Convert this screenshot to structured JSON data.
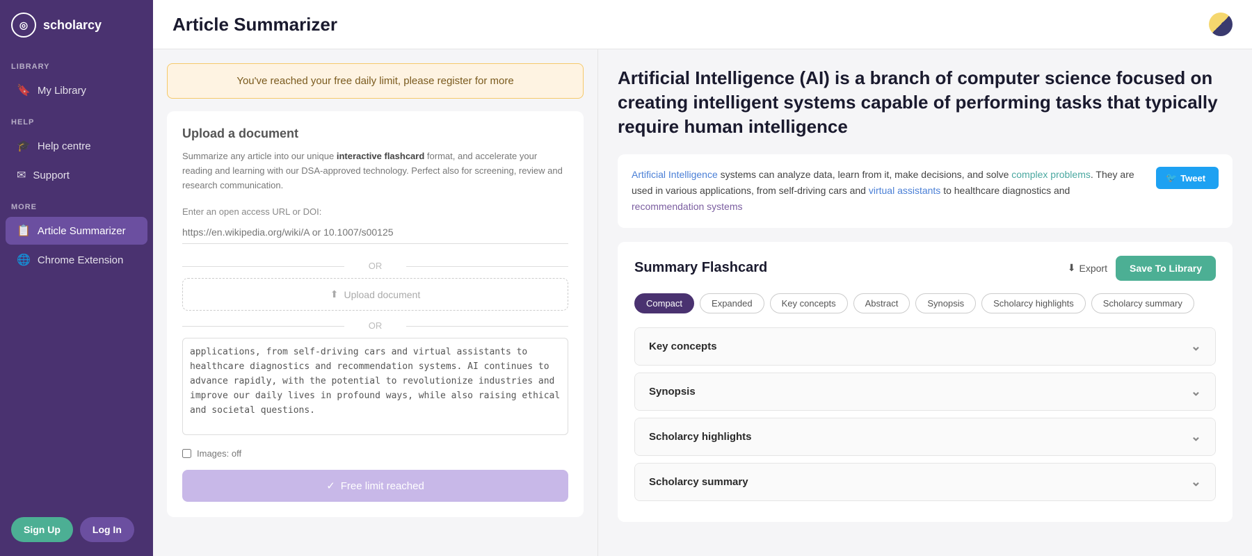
{
  "app": {
    "name": "scholarcy",
    "logo_symbol": "◎"
  },
  "sidebar": {
    "sections": [
      {
        "label": "LIBRARY",
        "items": [
          {
            "id": "my-library",
            "label": "My Library",
            "icon": "🔖",
            "active": false
          }
        ]
      },
      {
        "label": "HELP",
        "items": [
          {
            "id": "help-centre",
            "label": "Help centre",
            "icon": "🎓",
            "active": false
          },
          {
            "id": "support",
            "label": "Support",
            "icon": "✉",
            "active": false
          }
        ]
      },
      {
        "label": "MORE",
        "items": [
          {
            "id": "article-summarizer",
            "label": "Article Summarizer",
            "icon": "📋",
            "active": true
          },
          {
            "id": "chrome-extension",
            "label": "Chrome Extension",
            "icon": "🌐",
            "active": false
          }
        ]
      }
    ],
    "sign_up_label": "Sign Up",
    "log_in_label": "Log In"
  },
  "header": {
    "title": "Article Summarizer"
  },
  "left_panel": {
    "alert": {
      "text": "You've reached your free daily limit, please register for more"
    },
    "upload": {
      "title": "Upload a document",
      "description_plain": "Summarize any article into our unique ",
      "description_bold": "interactive flashcard",
      "description_rest": " format, and accelerate your reading and learning with our DSA-approved technology. Perfect also for screening, review and research communication.",
      "url_label": "Enter an open access URL or DOI:",
      "url_placeholder": "https://en.wikipedia.org/wiki/A or 10.1007/s00125",
      "or_label": "OR",
      "upload_btn_label": "Upload document",
      "or_label2": "OR",
      "textarea_content": "applications, from self-driving cars and virtual assistants to healthcare diagnostics and recommendation systems. AI continues to advance rapidly, with the potential to revolutionize industries and improve our daily lives in profound ways, while also raising ethical and societal questions.",
      "images_label": "Images: off",
      "free_limit_label": "Free limit reached"
    }
  },
  "right_panel": {
    "headline": "Artificial Intelligence (AI) is a branch of computer science focused on creating intelligent systems capable of performing tasks that typically require human intelligence",
    "excerpt": {
      "link1": "Artificial Intelligence",
      "text1": " systems can analyze data, learn from it, make decisions, and solve ",
      "link2": "complex problems",
      "text2": ". They are used in various applications, from self-driving cars and ",
      "link3": "virtual assistants",
      "text3": " to healthcare diagnostics and ",
      "link4": "recommendation systems",
      "tweet_label": "Tweet"
    },
    "flashcard": {
      "title": "Summary Flashcard",
      "export_label": "Export",
      "save_library_label": "Save To Library",
      "tabs": [
        {
          "id": "compact",
          "label": "Compact",
          "active": true
        },
        {
          "id": "expanded",
          "label": "Expanded",
          "active": false
        },
        {
          "id": "key-concepts",
          "label": "Key concepts",
          "active": false
        },
        {
          "id": "abstract",
          "label": "Abstract",
          "active": false
        },
        {
          "id": "synopsis",
          "label": "Synopsis",
          "active": false
        },
        {
          "id": "scholarcy-highlights",
          "label": "Scholarcy highlights",
          "active": false
        },
        {
          "id": "scholarcy-summary",
          "label": "Scholarcy summary",
          "active": false
        }
      ],
      "accordions": [
        {
          "id": "key-concepts",
          "label": "Key concepts"
        },
        {
          "id": "synopsis",
          "label": "Synopsis"
        },
        {
          "id": "scholarcy-highlights",
          "label": "Scholarcy highlights"
        },
        {
          "id": "scholarcy-summary",
          "label": "Scholarcy summary"
        }
      ]
    }
  }
}
